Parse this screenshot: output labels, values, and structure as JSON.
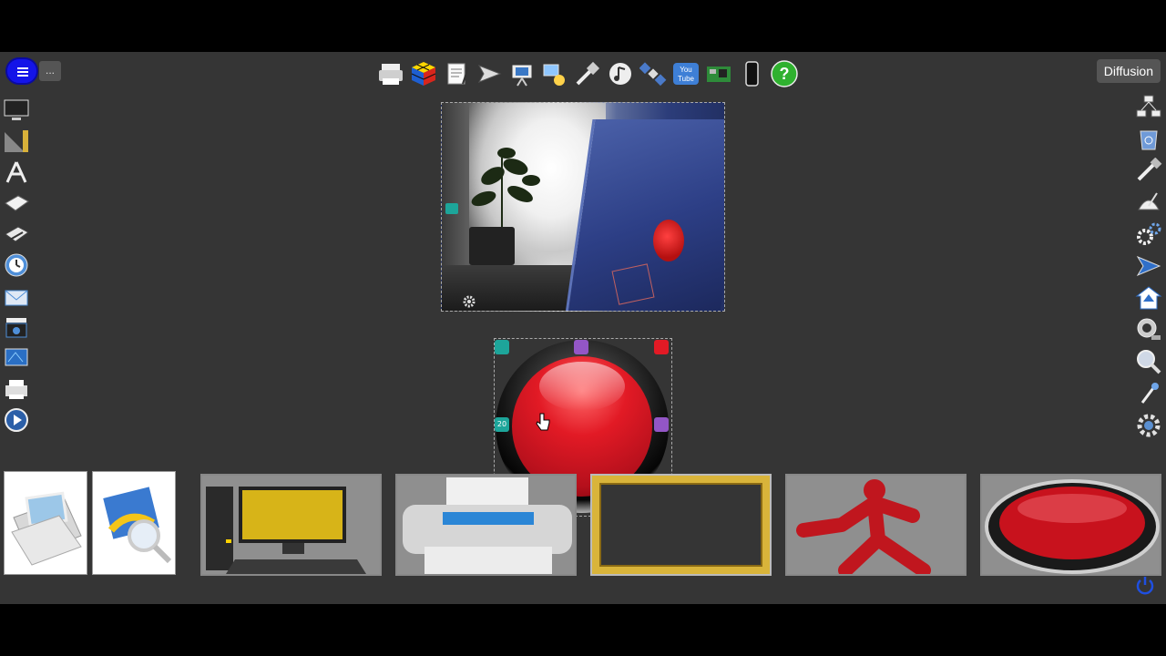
{
  "header": {
    "menu_icon": "hamburger-menu-icon",
    "more_label": "...",
    "diffusion_label": "Diffusion"
  },
  "top_toolbar": {
    "icons": [
      "printer-icon",
      "rubiks-cube-icon",
      "notepad-pen-icon",
      "send-arrow-icon",
      "presentation-icon",
      "network-icon",
      "plug-icon",
      "music-note-icon",
      "satellite-icon",
      "youtube-icon",
      "raspberry-pi-board-icon",
      "smartphone-icon",
      "help-icon"
    ],
    "help_label": "?",
    "youtube_label": "You Tube"
  },
  "left_sidebar": {
    "icons": [
      "monitor-icon",
      "ruler-triangle-icon",
      "compass-tool-icon",
      "laptop-icon",
      "scanner-icon",
      "clock-icon",
      "email-inbox-icon",
      "film-camera-icon",
      "desktop-screen-icon",
      "printer-scan-icon",
      "play-button-icon"
    ]
  },
  "right_sidebar": {
    "icons": [
      "network-computers-icon",
      "recycle-bin-icon",
      "tools-icon",
      "satellite-dish-icon",
      "gears-icon",
      "forward-arrow-icon",
      "home-upload-icon",
      "webcam-icon",
      "magnifier-icon",
      "antenna-icon",
      "settings-gear-icon"
    ]
  },
  "canvas": {
    "camera_widget": "camera-feed",
    "selected_widget": "red-push-button",
    "handles": {
      "top_left": "",
      "top": "",
      "top_right": "",
      "left": "20",
      "right": "",
      "bottom_right": ""
    }
  },
  "asset_strip": {
    "items": [
      "open-folder",
      "image-search",
      "desktop-computer",
      "printer",
      "gold-frame",
      "runner-sign",
      "red-oval-button"
    ]
  },
  "colors": {
    "stage_bg": "#353535",
    "menu_blue": "#1414e8",
    "accent_red": "#e21a25",
    "accent_teal": "#1da59a",
    "accent_purple": "#9356c6",
    "accent_green": "#6cc23a",
    "frame_gold": "#d9b43a"
  }
}
